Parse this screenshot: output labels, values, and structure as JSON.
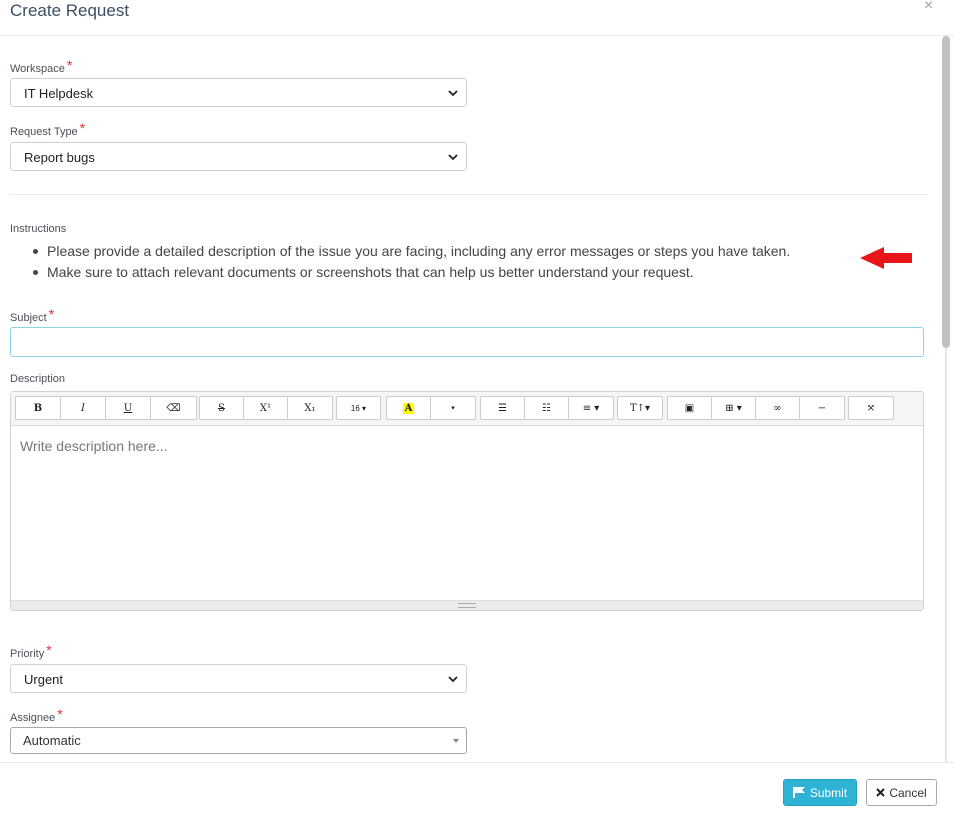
{
  "modal": {
    "title": "Create Request",
    "close_glyph": "×"
  },
  "workspace": {
    "label": "Workspace",
    "required": "*",
    "value": "IT Helpdesk"
  },
  "request_type": {
    "label": "Request Type",
    "required": "*",
    "value": "Report bugs"
  },
  "instructions": {
    "label": "Instructions",
    "items": [
      "Please provide a detailed description of the issue you are facing, including any error messages or steps you have taken.",
      "Make sure to attach relevant documents or screenshots that can help us better understand your request."
    ]
  },
  "subject": {
    "label": "Subject",
    "required": "*",
    "value": ""
  },
  "description": {
    "label": "Description",
    "placeholder": "Write description here...",
    "toolbar": {
      "bold": "B",
      "italic": "I",
      "underline": "U",
      "clear": "⌫",
      "strike": "S",
      "superscript": "X¹",
      "subscript": "X₁",
      "font_size": "16 ▾",
      "font_color": "A",
      "color_more": "▾",
      "ul": "☰",
      "ol": "☷",
      "align": "≡ ▾",
      "style": "T↑▾",
      "picture": "▣",
      "table": "⊞ ▾",
      "link": "∞",
      "hr": "−",
      "fullscreen": "⤧"
    }
  },
  "priority": {
    "label": "Priority",
    "required": "*",
    "value": "Urgent"
  },
  "assignee": {
    "label": "Assignee",
    "required": "*",
    "value": "Automatic"
  },
  "footer": {
    "submit_label": "Submit",
    "cancel_label": "Cancel"
  },
  "colors": {
    "accent": "#2fb3d4",
    "required": "#e03131",
    "arrow": "#e8161b",
    "title": "#3b4f66"
  }
}
